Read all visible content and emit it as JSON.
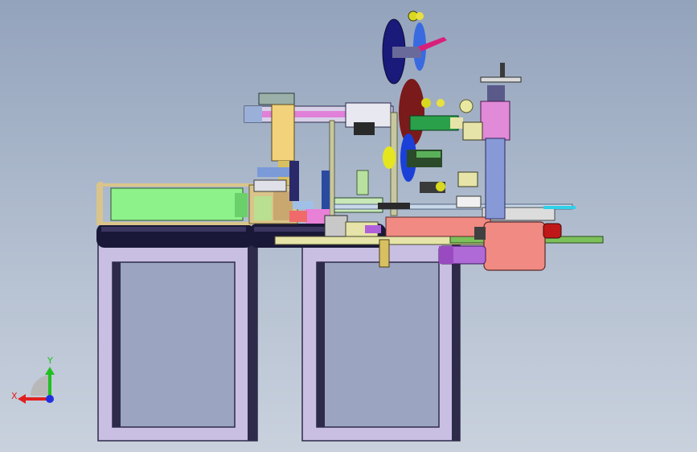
{
  "viewport": {
    "background_top": "#93a3bc",
    "background_bottom": "#c9d1dd"
  },
  "model": {
    "colors": {
      "frame_fill": "#c8bfe3",
      "frame_dark": "#2e2a4a",
      "frame_window": "#9ba5c2",
      "tube_dark": "#1a1838",
      "green_block": "#8ef28a",
      "pink_motor": "#f08a82",
      "blue_disk": "#1a40d8",
      "column_blue": "#8899d8",
      "column_pink": "#e08ad8",
      "rail_yellow": "#e6e4a8",
      "plate_green": "#7cc05a",
      "purple_cyl": "#b06ad8",
      "tan_frame": "#d9c48a",
      "dark_red_disk": "#7a1a1a"
    }
  },
  "triad": {
    "x_label": "X",
    "y_label": "Y",
    "x_color": "#e02020",
    "y_color": "#20c020",
    "z_color": "#2030e0"
  }
}
